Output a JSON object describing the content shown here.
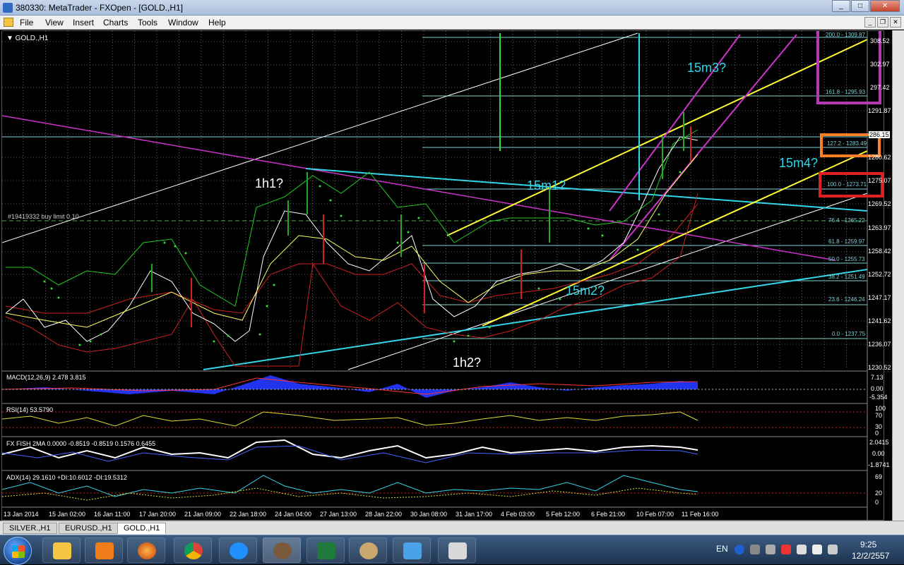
{
  "window": {
    "title": "380330: MetaTrader - FXOpen - [GOLD.,H1]"
  },
  "menu": {
    "items": [
      "File",
      "View",
      "Insert",
      "Charts",
      "Tools",
      "Window",
      "Help"
    ]
  },
  "chart": {
    "symbol_label": "▼ GOLD.,H1",
    "order_label": "#19419332 buy limit 0.10",
    "price_axis": [
      "308.52",
      "302.97",
      "297.42",
      "1291.87",
      "286.15",
      "1280.62",
      "1275.07",
      "1269.52",
      "1263.97",
      "1258.42",
      "1252.72",
      "1247.17",
      "1241.62",
      "1236.07",
      "1230.52"
    ],
    "time_axis": [
      "13 Jan 2014",
      "15 Jan 02:00",
      "16 Jan 11:00",
      "17 Jan 20:00",
      "21 Jan 09:00",
      "22 Jan 18:00",
      "24 Jan 04:00",
      "27 Jan 13:00",
      "28 Jan 22:00",
      "30 Jan 08:00",
      "31 Jan 17:00",
      "4 Feb 03:00",
      "5 Feb 12:00",
      "6 Feb 21:00",
      "10 Feb 07:00",
      "11 Feb 16:00"
    ],
    "fib_labels": [
      "200.0 - 1309.87",
      "161.8 - 1295.93",
      "127.2 - 1283.49",
      "100.0 - 1273.71",
      "76.4 - 1265.22",
      "61.8 - 1259.97",
      "50.0 - 1255.73",
      "38.2 - 1251.49",
      "23.6 - 1246.24",
      "0.0 - 1237.75"
    ],
    "annotations": {
      "h1": "1h1?",
      "h2": "1h2?",
      "m1": "15m1?",
      "m2": "15m2?",
      "m3": "15m3?",
      "m4": "15m4?"
    },
    "colors": {
      "fib": "#7ecfd6",
      "channel_yellow": "#ffff33",
      "trend_cyan": "#33d6e8",
      "magenta": "#cc33cc",
      "purple_box": "#b23bb2",
      "orange_box": "#ff7f27",
      "red_box": "#e02020"
    }
  },
  "indicators": {
    "macd": {
      "label": "MACD(12,26,9) 2.478 3.815",
      "axis": [
        "7.13",
        "0.00",
        "-5.354"
      ]
    },
    "rsi": {
      "label": "RSI(14) 53.5790",
      "axis": [
        "100",
        "70",
        "30",
        "0"
      ]
    },
    "fish": {
      "label": "FX FISH 2MA 0.0000 -0.8519 -0.8519 0.1576 0.6455",
      "axis": [
        "2.0415",
        "0.00",
        "-1.8741"
      ]
    },
    "adx": {
      "label": "ADX(14) 29.1610 +DI:10.6012 -DI:19.5312",
      "axis": [
        "69",
        "20",
        "0"
      ]
    }
  },
  "tabs": [
    "SILVER.,H1",
    "EURUSD.,H1",
    "GOLD.,H1"
  ],
  "tabs_active": 2,
  "taskbar": {
    "lang": "EN",
    "time": "9:25",
    "date": "12/2/2557",
    "apps": [
      "folder-icon",
      "media-player-icon",
      "firefox-icon",
      "chrome-icon",
      "ie-icon",
      "metatrader-icon",
      "excel-icon",
      "paint-icon",
      "remote-desktop-icon",
      "screen-icon"
    ]
  }
}
